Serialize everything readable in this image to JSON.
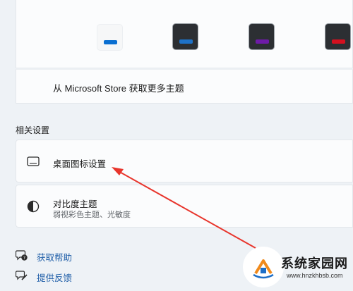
{
  "themes": {
    "thumbs": [
      {
        "name": "light",
        "accent": "#0a6fd1"
      },
      {
        "name": "dark-blue",
        "accent": "#1e72c8"
      },
      {
        "name": "dark-purple",
        "accent": "#6e1ba8"
      },
      {
        "name": "dark-red",
        "accent": "#d4101f"
      }
    ],
    "store_link": "从 Microsoft Store 获取更多主题"
  },
  "related": {
    "title": "相关设置",
    "desktop_icons": {
      "label": "桌面图标设置",
      "icon": "monitor-icon"
    },
    "contrast": {
      "label": "对比度主题",
      "sublabel": "弱视彩色主题、光敏度",
      "icon": "contrast-icon"
    }
  },
  "footer": {
    "help": {
      "label": "获取帮助",
      "icon": "help-chat-icon"
    },
    "feedback": {
      "label": "提供反馈",
      "icon": "feedback-icon"
    }
  },
  "watermark": {
    "text": "系统家园网",
    "url": "www.hnzkhbsb.com"
  },
  "annotation": {
    "color": "#e8352c"
  }
}
